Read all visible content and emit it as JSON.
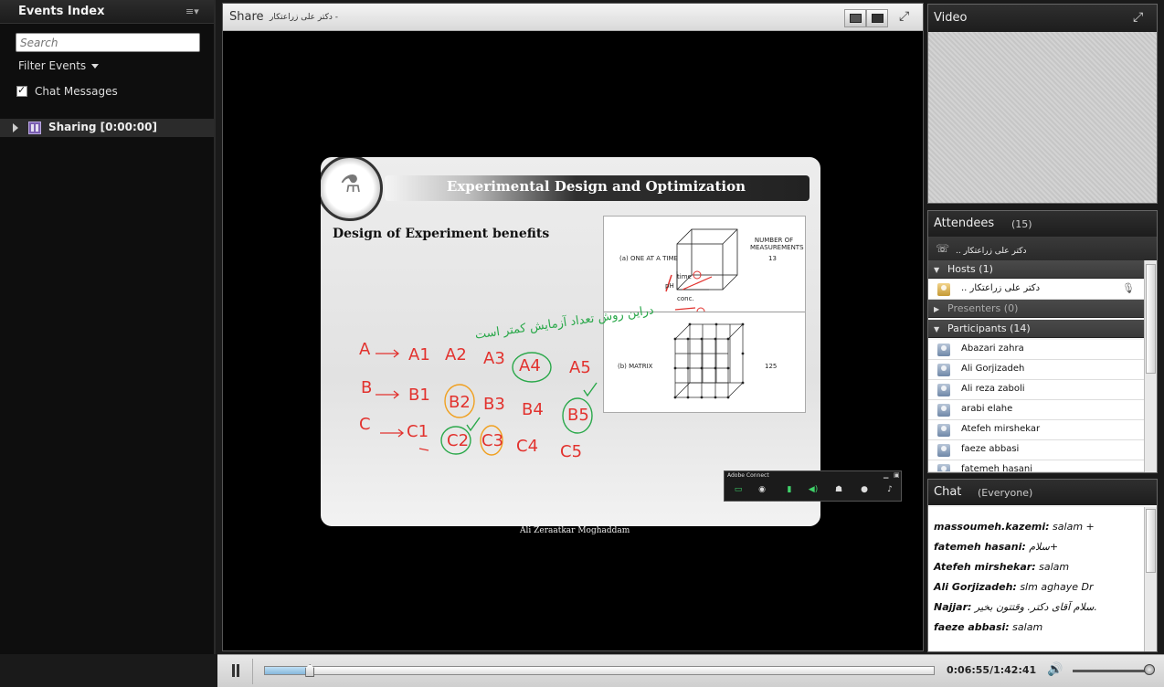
{
  "events_panel": {
    "title": "Events Index",
    "menu_icon": "list-menu-icon",
    "search_placeholder": "Search",
    "filter_label": "Filter Events",
    "chat_messages_label": "Chat Messages",
    "chat_messages_checked": true,
    "sharing_item": "Sharing [0:00:00]"
  },
  "share_pod": {
    "title": "Share",
    "presenter": "- دکتر علی زراعتکار",
    "slide": {
      "title": "Experimental Design and Optimization",
      "subtitle": "Design of Experiment benefits",
      "caption": "Ali Zeraatkar Moghaddam",
      "figure_top": {
        "label": "(a) ONE AT A TIME",
        "axis_ph": "pH",
        "axis_time": "time",
        "axis_conc": "conc.",
        "header": "NUMBER OF\nMEASUREMENTS",
        "value": "13"
      },
      "figure_bottom": {
        "label": "(b) MATRIX",
        "value": "125"
      },
      "handwriting": {
        "persian_note": "دراین روش تعداد آزمایش کمتر است",
        "row_a": [
          "A",
          "A1",
          "A2",
          "A3",
          "A4",
          "A5"
        ],
        "row_b": [
          "B",
          "B1",
          "B2",
          "B3",
          "B4",
          "B5"
        ],
        "row_c": [
          "C",
          "C1",
          "C2",
          "C3",
          "C4",
          "C5"
        ]
      }
    },
    "mini_toolbar": {
      "title": "Adobe Connect"
    }
  },
  "video_pod": {
    "title": "Video"
  },
  "attendees_pod": {
    "title": "Attendees",
    "count": "(15)",
    "me": "دکتر علی زراعتکار ..",
    "hosts_label": "Hosts (1)",
    "hosts": [
      "دکتر علی زراعتکار .."
    ],
    "presenters_label": "Presenters (0)",
    "participants_label": "Participants (14)",
    "participants": [
      "Abazari zahra",
      "Ali Gorjizadeh",
      "Ali reza zaboli",
      "arabi elahe",
      "Atefeh mirshekar",
      "faeze abbasi",
      "fatemeh hasani"
    ]
  },
  "chat_pod": {
    "title": "Chat",
    "audience": "(Everyone)",
    "messages": [
      {
        "author": "massoumeh.kazemi:",
        "text": "salam +"
      },
      {
        "author": "fatemeh hasani:",
        "text": "سلام+"
      },
      {
        "author": "Atefeh mirshekar:",
        "text": "salam"
      },
      {
        "author": "Ali Gorjizadeh:",
        "text": "slm aghaye Dr"
      },
      {
        "author": "Najjar:",
        "text": "سلام آقای دکتر. وقتتون بخیر."
      },
      {
        "author": "faeze abbasi:",
        "text": "salam"
      }
    ]
  },
  "playback": {
    "time": "0:06:55/1:42:41",
    "progress_fraction": 0.0673,
    "volume_fraction": 1.0
  },
  "colors": {
    "ink_red": "#e2322e",
    "ink_green": "#2aa84a",
    "ink_orange": "#f0a020",
    "host_badge": "#c59a35"
  }
}
